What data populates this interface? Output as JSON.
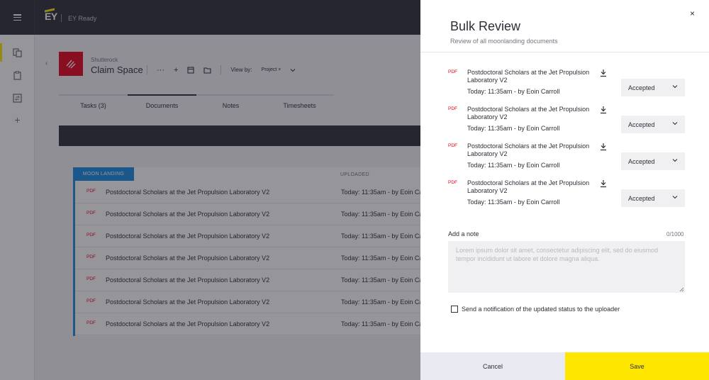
{
  "app": {
    "logo_text": "EY",
    "title": "EY Ready",
    "brand_yellow": "#ffe600",
    "brand_dark": "#2e2e38"
  },
  "sidenav": {
    "icons": [
      "documents-icon",
      "clipboard-icon",
      "switch-icon",
      "plus-icon"
    ]
  },
  "project": {
    "parent": "Shutterock",
    "name": "Claim Space",
    "tile_color": "#ea011b",
    "more_label": "···",
    "view_by_label": "View by:",
    "view_by_chip": "Project",
    "chip_remove": "×"
  },
  "tabs": [
    {
      "label": "Tasks (3)"
    },
    {
      "label": "Documents"
    },
    {
      "label": "Notes"
    },
    {
      "label": "Timesheets"
    }
  ],
  "documents": {
    "group_label": "MOON LANDING",
    "uploaded_header": "UPLOADED",
    "rows": [
      {
        "type": "PDF",
        "name": "Postdoctoral Scholars at the Jet Propulsion Laboratory V2",
        "uploaded": "Today: 11:35am   - by Eoin Ca"
      },
      {
        "type": "PDF",
        "name": "Postdoctoral Scholars at the Jet Propulsion Laboratory V2",
        "uploaded": "Today: 11:35am   - by Eoin Ca"
      },
      {
        "type": "PDF",
        "name": "Postdoctoral Scholars at the Jet Propulsion Laboratory V2",
        "uploaded": "Today: 11:35am   - by Eoin Ca"
      },
      {
        "type": "PDF",
        "name": "Postdoctoral Scholars at the Jet Propulsion Laboratory V2",
        "uploaded": "Today: 11:35am   - by Eoin Ca"
      },
      {
        "type": "PDF",
        "name": "Postdoctoral Scholars at the Jet Propulsion Laboratory V2",
        "uploaded": "Today: 11:35am   - by Eoin Ca"
      },
      {
        "type": "PDF",
        "name": "Postdoctoral Scholars at the Jet Propulsion Laboratory V2",
        "uploaded": "Today: 11:35am   - by Eoin Ca"
      },
      {
        "type": "PDF",
        "name": "Postdoctoral Scholars at the Jet Propulsion Laboratory V2",
        "uploaded": "Today: 11:35am   - by Eoin Ca"
      }
    ]
  },
  "drawer": {
    "close": "×",
    "title": "Bulk Review",
    "subtitle": "Review of all moonlanding documents",
    "items": [
      {
        "type": "PDF",
        "name": "Postdoctoral Scholars at the Jet Propulsion Laboratory V2",
        "meta": "Today: 11:35am   - by Eoin Carroll",
        "status": "Accepted"
      },
      {
        "type": "PDF",
        "name": "Postdoctoral Scholars at the Jet Propulsion Laboratory V2",
        "meta": "Today: 11:35am   - by Eoin Carroll",
        "status": "Accepted"
      },
      {
        "type": "PDF",
        "name": "Postdoctoral Scholars at the Jet Propulsion Laboratory V2",
        "meta": "Today: 11:35am   - by Eoin Carroll",
        "status": "Accepted"
      },
      {
        "type": "PDF",
        "name": "Postdoctoral Scholars at the Jet Propulsion Laboratory V2",
        "meta": "Today: 11:35am   - by Eoin Carroll",
        "status": "Accepted"
      }
    ],
    "note": {
      "label": "Add a note",
      "count": "0/1000",
      "value": "",
      "placeholder": "Lorem ipsum dolor sit amet, consectetur adipiscing elit, sed do eiusmod tempor incididunt ut labore et dolore magna aliqua."
    },
    "notify": {
      "checked": false,
      "label": "Send a notification of the updated status to the uploader"
    },
    "cancel_label": "Cancel",
    "save_label": "Save",
    "pdf_color": "#ea011b"
  }
}
